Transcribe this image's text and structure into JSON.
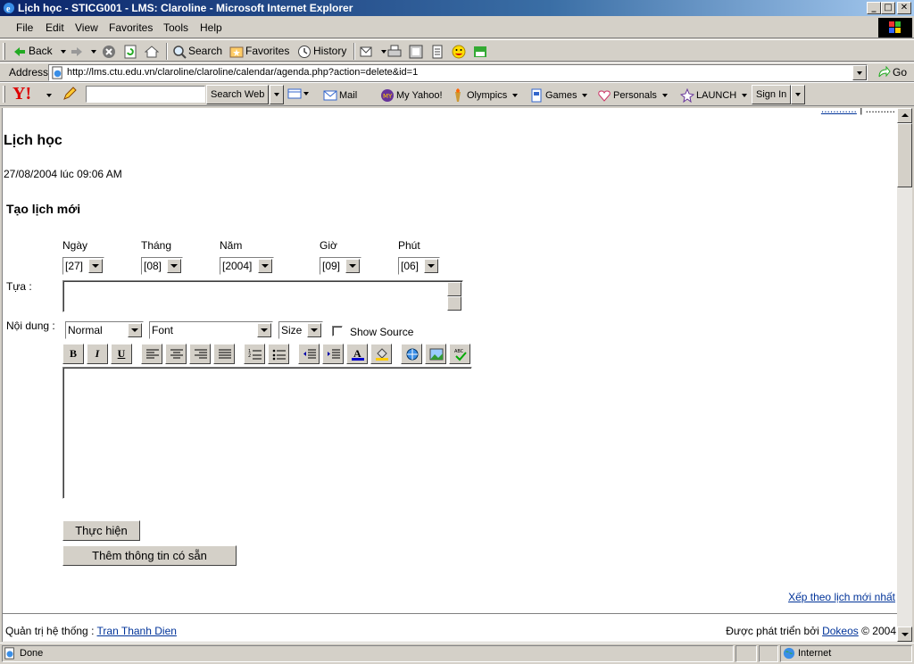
{
  "window": {
    "title": "Lịch học - STICG001 - LMS: Claroline - Microsoft Internet Explorer",
    "min_label": "_",
    "max_label": "□",
    "close_label": "✕"
  },
  "menu": [
    "File",
    "Edit",
    "View",
    "Favorites",
    "Tools",
    "Help"
  ],
  "toolbar": {
    "back": "Back",
    "search": "Search",
    "favorites": "Favorites",
    "history": "History"
  },
  "address": {
    "label": "Address",
    "url": "http://lms.ctu.edu.vn/claroline/claroline/calendar/agenda.php?action=delete&id=1",
    "go": "Go"
  },
  "yahoo": {
    "search_value": "",
    "search_web": "Search Web",
    "mail": "Mail",
    "my_yahoo": "My Yahoo!",
    "olympics": "Olympics",
    "games": "Games",
    "personals": "Personals",
    "launch": "LAUNCH",
    "sign_in": "Sign In"
  },
  "page": {
    "title": "Lịch học",
    "datetime": "27/08/2004 lúc 09:06 AM",
    "section_title": "Tạo lịch mới",
    "date_labels": {
      "day": "Ngày",
      "month": "Tháng",
      "year": "Năm",
      "hour": "Giờ",
      "minute": "Phút"
    },
    "date_values": {
      "day": "[27]",
      "month": "[08]",
      "year": "[2004]",
      "hour": "[09]",
      "minute": "[06]"
    },
    "title_label": "Tựa :",
    "title_value": "",
    "content_label": "Nội dung :",
    "editor": {
      "format": "Normal",
      "font": "Font",
      "size": "Size",
      "show_source": "Show Source",
      "bold": "B",
      "italic": "I",
      "underline": "U"
    },
    "submit": "Thực hiện",
    "add_existing": "Thêm thông tin có sẵn",
    "sort_link": "Xếp theo lịch mới nhất"
  },
  "footer": {
    "admin_label": "Quản trị hệ thống :",
    "admin_name": "Tran Thanh Dien",
    "powered_label": "Được phát triển bởi",
    "powered_name": "Dokeos",
    "copyright": "© 2004"
  },
  "status": {
    "text": "Done",
    "zone": "Internet"
  }
}
